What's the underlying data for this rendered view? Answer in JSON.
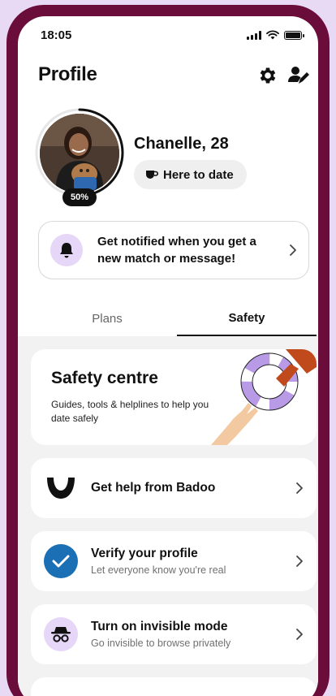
{
  "status_bar": {
    "time": "18:05",
    "icons": [
      "signal-icon",
      "wifi-icon",
      "battery-icon"
    ]
  },
  "header": {
    "title": "Profile",
    "icons": [
      "gear-icon",
      "edit-profile-icon"
    ]
  },
  "profile": {
    "name": "Chanelle, 28",
    "completion_badge": "50%",
    "completion": 0.5,
    "intent_chip": {
      "icon": "coffee-cup-icon",
      "label": "Here to date"
    }
  },
  "notify_card": {
    "icon": "bell-icon",
    "text": "Get notified when you get a new match or message!"
  },
  "tabs": [
    {
      "label": "Plans",
      "active": false
    },
    {
      "label": "Safety",
      "active": true
    }
  ],
  "safety_centre": {
    "title": "Safety centre",
    "subtitle": "Guides, tools & helplines to help you date safely"
  },
  "rows": [
    {
      "icon": "badoo-logo-icon",
      "title": "Get help from Badoo",
      "subtitle": ""
    },
    {
      "icon": "checkmark-icon",
      "title": "Verify your profile",
      "subtitle": "Let everyone know you're real"
    },
    {
      "icon": "incognito-icon",
      "title": "Turn on invisible mode",
      "subtitle": "Go invisible to browse privately"
    }
  ],
  "colors": {
    "frame": "#6a0d3b",
    "background": "#e8d9f5",
    "accent_lavender": "#e6d6f7",
    "verify_blue": "#1a6fb5"
  }
}
